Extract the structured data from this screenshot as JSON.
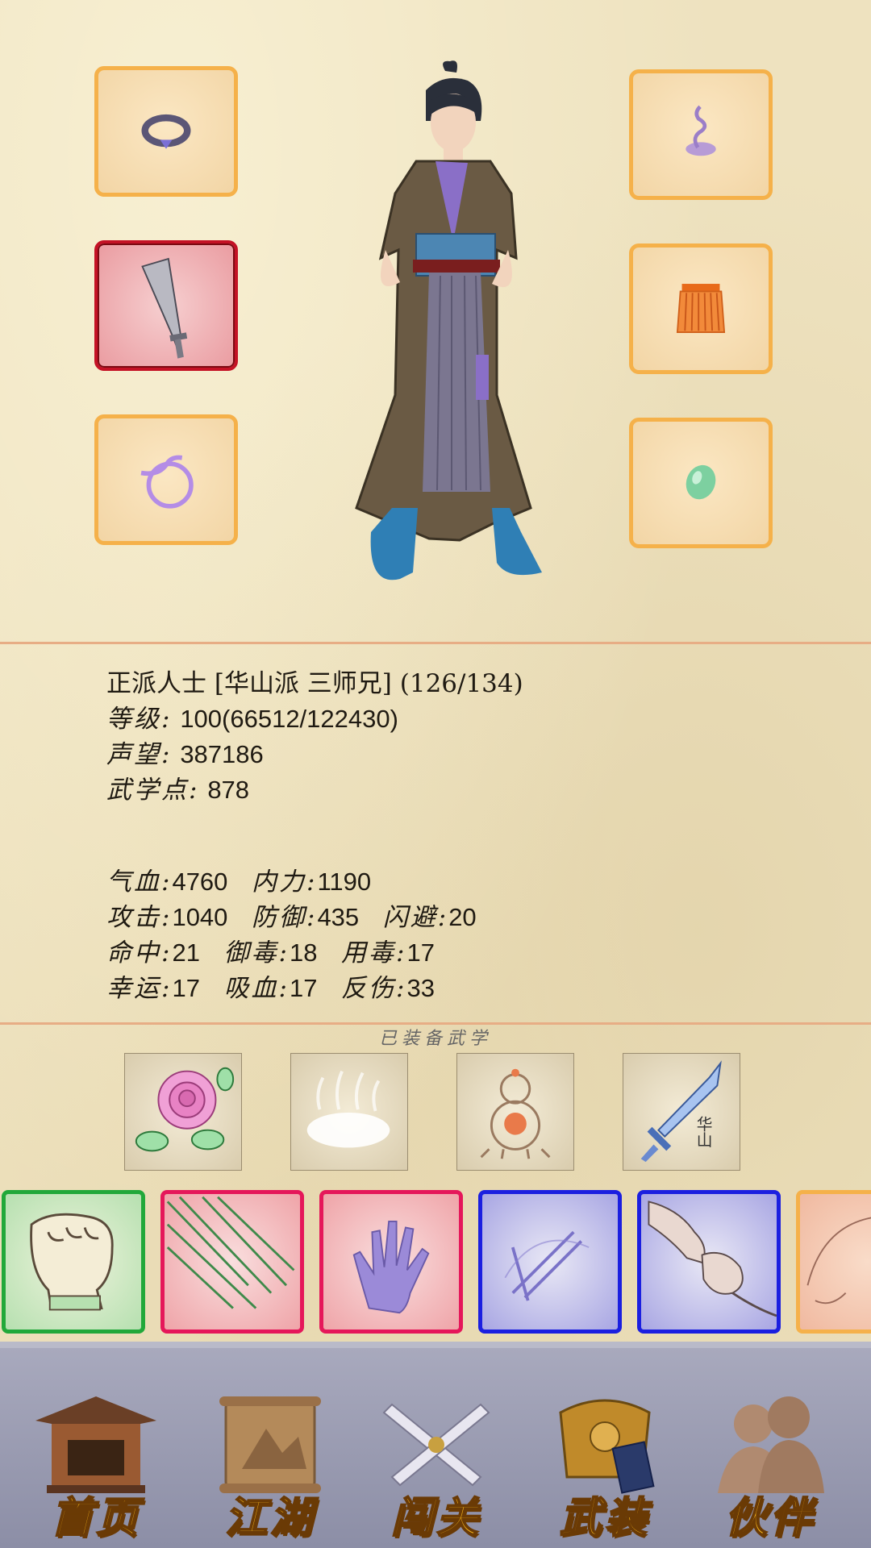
{
  "equipment": {
    "left_slots": [
      "ring-icon",
      "saber-icon",
      "bracelet-icon"
    ],
    "right_slots": [
      "incense-icon",
      "belt-skirt-icon",
      "jade-icon"
    ],
    "selected": "saber-icon"
  },
  "character": {
    "title_line": "正派人士 [华山派 三师兄] (126/134)",
    "level_label": "等级:",
    "level_value": "100(66512/122430)",
    "fame_label": "声望:",
    "fame_value": "387186",
    "points_label": "武学点:",
    "points_value": "878"
  },
  "attributes": {
    "row1": [
      {
        "label": "气血:",
        "value": "4760"
      },
      {
        "label": "内力:",
        "value": "1190"
      }
    ],
    "row2": [
      {
        "label": "攻击:",
        "value": "1040"
      },
      {
        "label": "防御:",
        "value": "435"
      },
      {
        "label": "闪避:",
        "value": "20"
      }
    ],
    "row3": [
      {
        "label": "命中:",
        "value": "21"
      },
      {
        "label": "御毒:",
        "value": "18"
      },
      {
        "label": "用毒:",
        "value": "17"
      }
    ],
    "row4": [
      {
        "label": "幸运:",
        "value": "17"
      },
      {
        "label": "吸血:",
        "value": "17"
      },
      {
        "label": "反伤:",
        "value": "33"
      }
    ]
  },
  "equipped_skills": {
    "title": "已装备武学",
    "items": [
      "rose-icon",
      "mist-icon",
      "gourd-icon",
      "huashan-sword-icon"
    ],
    "sword_tag": "华山"
  },
  "skill_cards": [
    {
      "icon": "fist-icon",
      "color": "green"
    },
    {
      "icon": "needles-icon",
      "color": "red"
    },
    {
      "icon": "palm-icon",
      "color": "red"
    },
    {
      "icon": "staff-icon",
      "color": "blue"
    },
    {
      "icon": "grapple-icon",
      "color": "blue"
    },
    {
      "icon": "partial-card-icon",
      "color": "orange"
    }
  ],
  "nav": [
    {
      "label": "首页",
      "icon": "house-icon"
    },
    {
      "label": "江湖",
      "icon": "scroll-icon"
    },
    {
      "label": "闯关",
      "icon": "crossed-swords-icon"
    },
    {
      "label": "武装",
      "icon": "armor-icon"
    },
    {
      "label": "伙伴",
      "icon": "partners-icon"
    }
  ],
  "colors": {
    "slot_border": "#f5b14a",
    "selected_border": "#c41225",
    "nav_text": "#f2b21a",
    "card_green": "#22a83a",
    "card_red": "#e5175a",
    "card_blue": "#1b1fe0"
  }
}
